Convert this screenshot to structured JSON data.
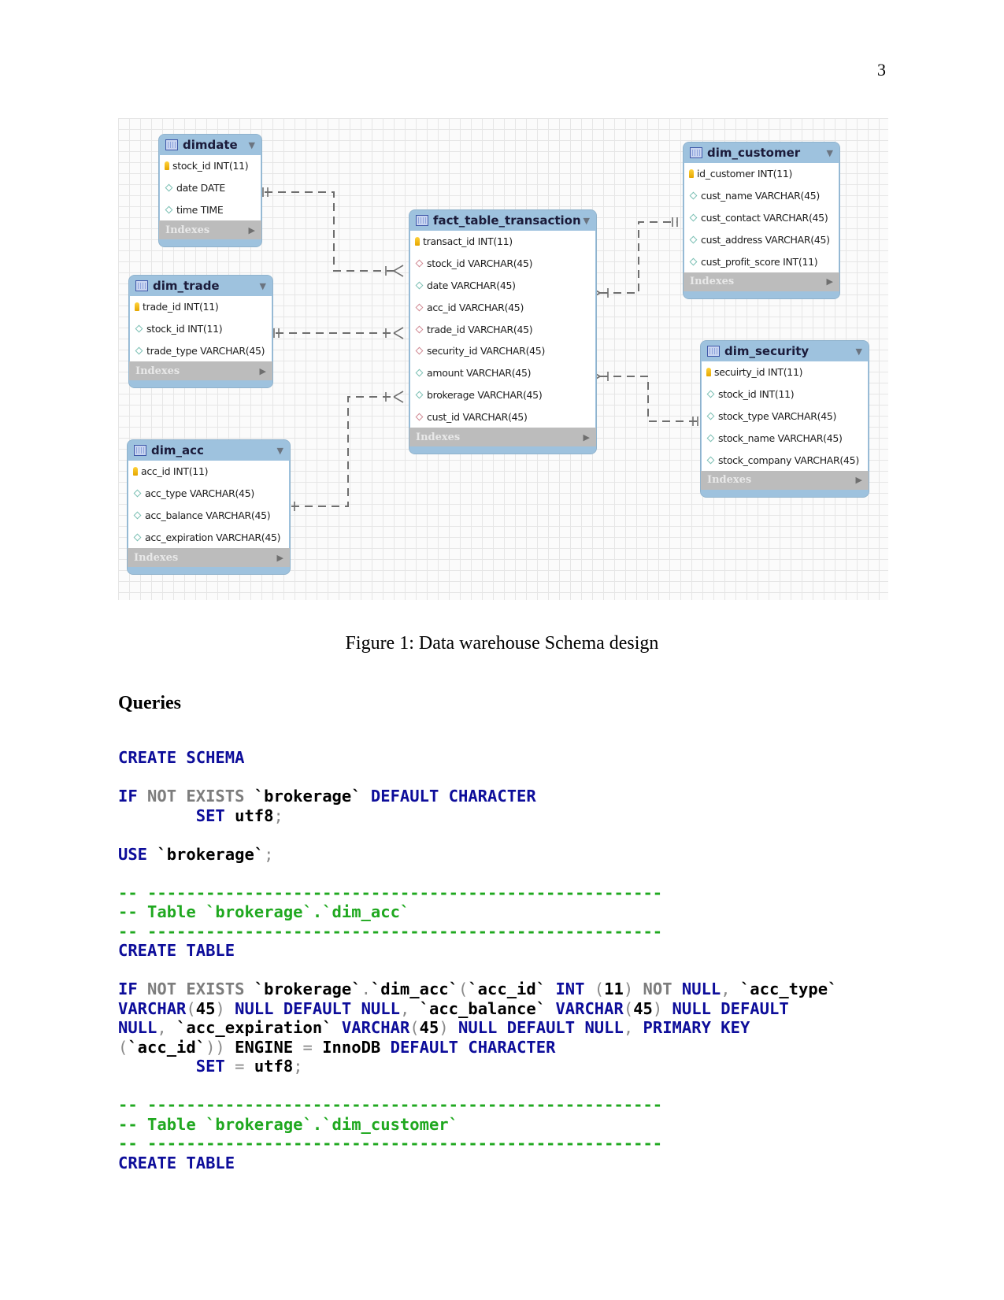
{
  "page_number": "3",
  "figure": {
    "caption": "Figure 1: Data warehouse Schema design",
    "indexes_label": "Indexes",
    "entities": {
      "dimdate": {
        "name": "dimdate",
        "columns": [
          {
            "text": "stock_id INT(11)",
            "kind": "pk"
          },
          {
            "text": "date DATE",
            "kind": "col"
          },
          {
            "text": "time TIME",
            "kind": "col"
          }
        ]
      },
      "dim_trade": {
        "name": "dim_trade",
        "columns": [
          {
            "text": "trade_id INT(11)",
            "kind": "pk"
          },
          {
            "text": "stock_id INT(11)",
            "kind": "col"
          },
          {
            "text": "trade_type VARCHAR(45)",
            "kind": "col"
          }
        ]
      },
      "dim_acc": {
        "name": "dim_acc",
        "columns": [
          {
            "text": "acc_id INT(11)",
            "kind": "pk"
          },
          {
            "text": "acc_type VARCHAR(45)",
            "kind": "col"
          },
          {
            "text": "acc_balance VARCHAR(45)",
            "kind": "col"
          },
          {
            "text": "acc_expiration VARCHAR(45)",
            "kind": "col"
          }
        ]
      },
      "fact_table_transaction": {
        "name": "fact_table_transaction",
        "columns": [
          {
            "text": "transact_id INT(11)",
            "kind": "pk"
          },
          {
            "text": "stock_id VARCHAR(45)",
            "kind": "fk"
          },
          {
            "text": "date VARCHAR(45)",
            "kind": "col"
          },
          {
            "text": "acc_id VARCHAR(45)",
            "kind": "fk"
          },
          {
            "text": "trade_id VARCHAR(45)",
            "kind": "fk"
          },
          {
            "text": "security_id VARCHAR(45)",
            "kind": "fk"
          },
          {
            "text": "amount VARCHAR(45)",
            "kind": "col"
          },
          {
            "text": "brokerage VARCHAR(45)",
            "kind": "col"
          },
          {
            "text": "cust_id VARCHAR(45)",
            "kind": "fk"
          }
        ]
      },
      "dim_customer": {
        "name": "dim_customer",
        "columns": [
          {
            "text": "id_customer INT(11)",
            "kind": "pk"
          },
          {
            "text": "cust_name VARCHAR(45)",
            "kind": "col"
          },
          {
            "text": "cust_contact VARCHAR(45)",
            "kind": "col"
          },
          {
            "text": "cust_address VARCHAR(45)",
            "kind": "col"
          },
          {
            "text": "cust_profit_score INT(11)",
            "kind": "col"
          }
        ]
      },
      "dim_security": {
        "name": "dim_security",
        "columns": [
          {
            "text": "secuirty_id INT(11)",
            "kind": "pk"
          },
          {
            "text": "stock_id INT(11)",
            "kind": "col"
          },
          {
            "text": "stock_type VARCHAR(45)",
            "kind": "col"
          },
          {
            "text": "stock_name VARCHAR(45)",
            "kind": "col"
          },
          {
            "text": "stock_company VARCHAR(45)",
            "kind": "col"
          }
        ]
      }
    }
  },
  "section_heading": "Queries",
  "code": {
    "l1": {
      "a": "CREATE SCHEMA"
    },
    "l2": {
      "a": "IF",
      "b": " NOT EXISTS",
      "c": " `brokerage` ",
      "d": "DEFAULT CHARACTER"
    },
    "l3": {
      "a": "SET",
      "b": " utf8",
      "c": ";"
    },
    "l4": {
      "a": "USE",
      "b": " `brokerage`",
      "c": ";"
    },
    "rule": "-- -----------------------------------------------------",
    "l5": "-- Table `brokerage`.`dim_acc`",
    "l6": {
      "a": "CREATE TABLE"
    },
    "l7": {
      "a": "IF",
      "b": " NOT EXISTS",
      "c": " `brokerage`",
      "d": ".",
      "e": "`dim_acc`",
      "f": "(",
      "g": "`acc_id` ",
      "h": "INT",
      "i": " (",
      "j": "11",
      "k": ")",
      "l": " NOT",
      "m": " NULL",
      "n": ",",
      "o": " `acc_type`"
    },
    "l8": {
      "a": "VARCHAR",
      "b": "(",
      "c": "45",
      "d": ")",
      "e": " NULL DEFAULT NULL",
      "f": ",",
      "g": " `acc_balance` ",
      "h": "VARCHAR",
      "i": "(",
      "j": "45",
      "k": ")",
      "l": " NULL DEFAULT"
    },
    "l9": {
      "a": "NULL",
      "b": ",",
      "c": " `acc_expiration` ",
      "d": "VARCHAR",
      "e": "(",
      "f": "45",
      "g": ")",
      "h": " NULL DEFAULT NULL",
      "i": ",",
      "j": " PRIMARY KEY"
    },
    "l10": {
      "a": "(",
      "b": "`acc_id`",
      "c": "))",
      "d": " ENGINE ",
      "e": "=",
      "f": " InnoDB ",
      "g": "DEFAULT CHARACTER"
    },
    "l11": {
      "a": "SET",
      "b": " = ",
      "c": "utf8",
      "d": ";"
    },
    "l12": "-- Table `brokerage`.`dim_customer`",
    "l13": {
      "a": "CREATE TABLE"
    }
  }
}
